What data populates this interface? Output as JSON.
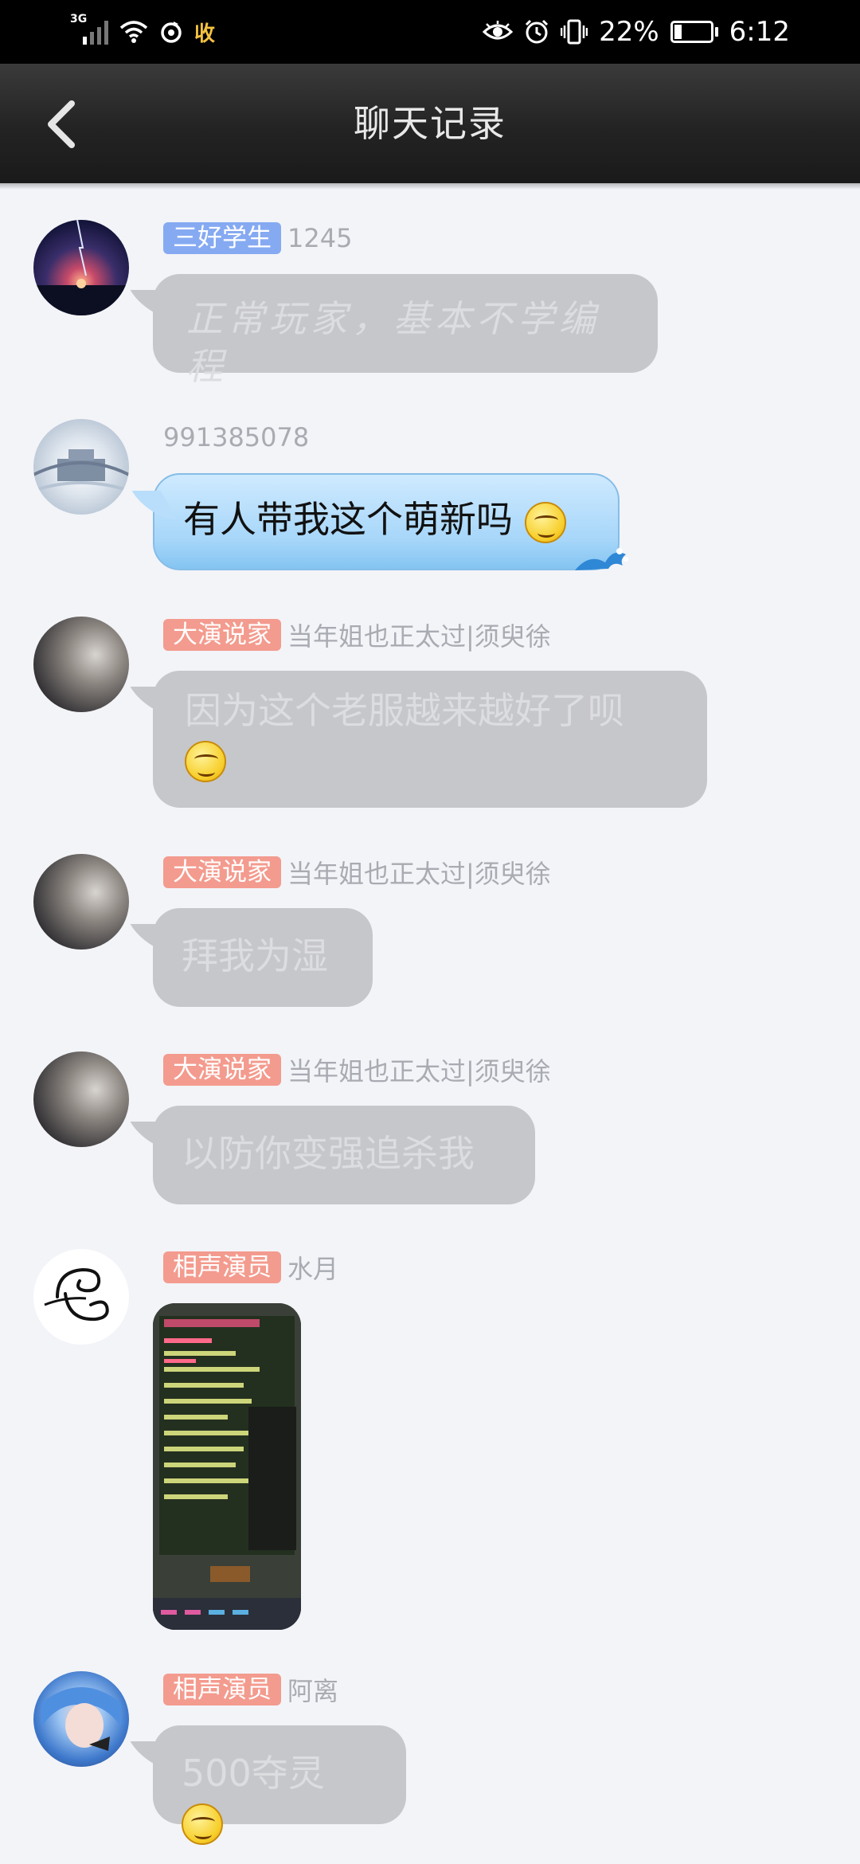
{
  "status_bar": {
    "network": "3G",
    "receive_label": "收",
    "battery_percent": "22%",
    "time": "6:12"
  },
  "header": {
    "title": "聊天记录"
  },
  "messages": [
    {
      "badge": "三好学生",
      "badge_color": "#86aaf2",
      "nickname": "1245",
      "text": "正常玩家，基本不学编程",
      "avatar": "night-sky-avatar"
    },
    {
      "badge": "",
      "nickname": "991385078",
      "text": "有人带我这个萌新吗",
      "avatar": "snow-temple-avatar"
    },
    {
      "badge": "大演说家",
      "badge_color": "#f39b8e",
      "nickname": "当年姐也正太过|须臾徐",
      "text": "因为这个老服越来越好了呗",
      "avatar": "dark-girl-avatar"
    },
    {
      "badge": "大演说家",
      "badge_color": "#f39b8e",
      "nickname": "当年姐也正太过|须臾徐",
      "text": "拜我为湿",
      "avatar": "dark-girl-avatar"
    },
    {
      "badge": "大演说家",
      "badge_color": "#f39b8e",
      "nickname": "当年姐也正太过|须臾徐",
      "text": "以防你变强追杀我",
      "avatar": "dark-girl-avatar"
    },
    {
      "badge": "相声演员",
      "badge_color": "#f39b8e",
      "nickname": "水月",
      "text": "",
      "avatar": "calligraphy-avatar"
    },
    {
      "badge": "相声演员",
      "badge_color": "#f39b8e",
      "nickname": "阿离",
      "text": "500夺灵",
      "avatar": "blue-hair-avatar"
    }
  ]
}
